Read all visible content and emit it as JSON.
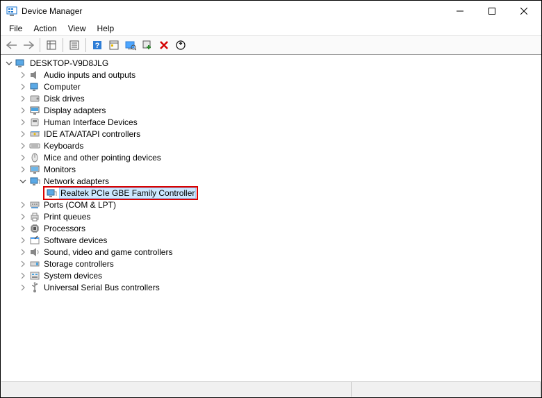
{
  "window": {
    "title": "Device Manager"
  },
  "menu": [
    "File",
    "Action",
    "View",
    "Help"
  ],
  "root": "DESKTOP-V9D8JLG",
  "categories": [
    {
      "label": "Audio inputs and outputs",
      "icon": "audio",
      "expanded": false
    },
    {
      "label": "Computer",
      "icon": "computer",
      "expanded": false
    },
    {
      "label": "Disk drives",
      "icon": "disk",
      "expanded": false
    },
    {
      "label": "Display adapters",
      "icon": "display",
      "expanded": false
    },
    {
      "label": "Human Interface Devices",
      "icon": "hid",
      "expanded": false
    },
    {
      "label": "IDE ATA/ATAPI controllers",
      "icon": "ide",
      "expanded": false
    },
    {
      "label": "Keyboards",
      "icon": "keyboard",
      "expanded": false
    },
    {
      "label": "Mice and other pointing devices",
      "icon": "mouse",
      "expanded": false
    },
    {
      "label": "Monitors",
      "icon": "monitor",
      "expanded": false
    },
    {
      "label": "Network adapters",
      "icon": "network",
      "expanded": true,
      "children": [
        {
          "label": "Realtek PCIe GBE Family Controller",
          "icon": "network",
          "selected": true,
          "highlighted": true
        }
      ]
    },
    {
      "label": "Ports (COM & LPT)",
      "icon": "ports",
      "expanded": false
    },
    {
      "label": "Print queues",
      "icon": "printer",
      "expanded": false
    },
    {
      "label": "Processors",
      "icon": "processor",
      "expanded": false
    },
    {
      "label": "Software devices",
      "icon": "software",
      "expanded": false
    },
    {
      "label": "Sound, video and game controllers",
      "icon": "sound",
      "expanded": false
    },
    {
      "label": "Storage controllers",
      "icon": "storage",
      "expanded": false
    },
    {
      "label": "System devices",
      "icon": "system",
      "expanded": false
    },
    {
      "label": "Universal Serial Bus controllers",
      "icon": "usb",
      "expanded": false
    }
  ]
}
